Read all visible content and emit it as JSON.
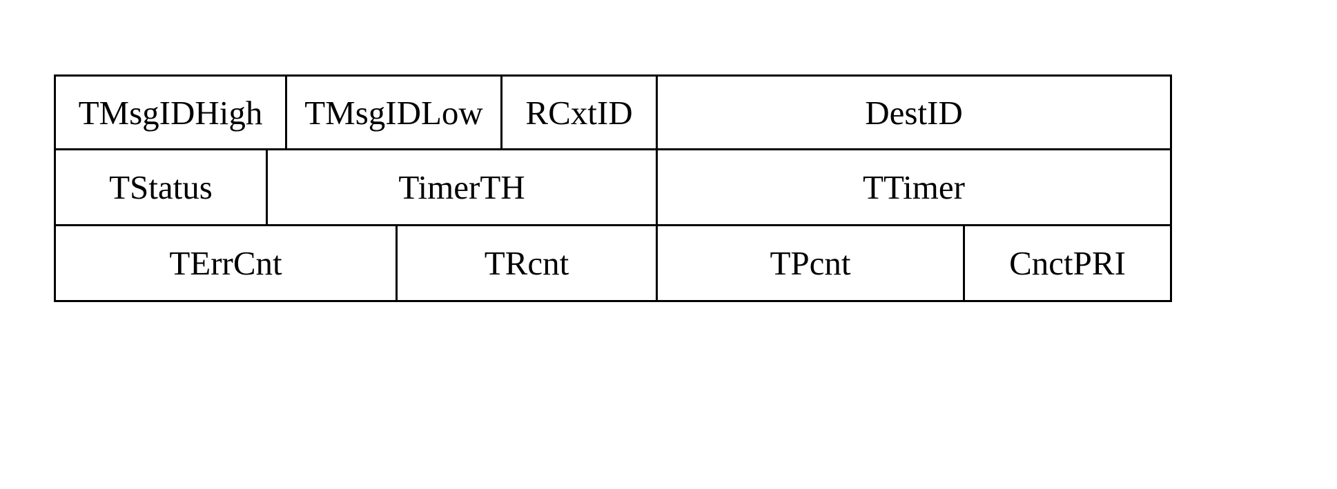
{
  "rows": [
    {
      "cells": [
        {
          "label": "TMsgIDHigh"
        },
        {
          "label": "TMsgIDLow"
        },
        {
          "label": "RCxtID"
        },
        {
          "label": "DestID"
        }
      ]
    },
    {
      "cells": [
        {
          "label": "TStatus"
        },
        {
          "label": "TimerTH"
        },
        {
          "label": "TTimer"
        }
      ]
    },
    {
      "cells": [
        {
          "label": "TErrCnt"
        },
        {
          "label": "TRcnt"
        },
        {
          "label": "TPcnt"
        },
        {
          "label": "CnctPRI"
        }
      ]
    }
  ]
}
